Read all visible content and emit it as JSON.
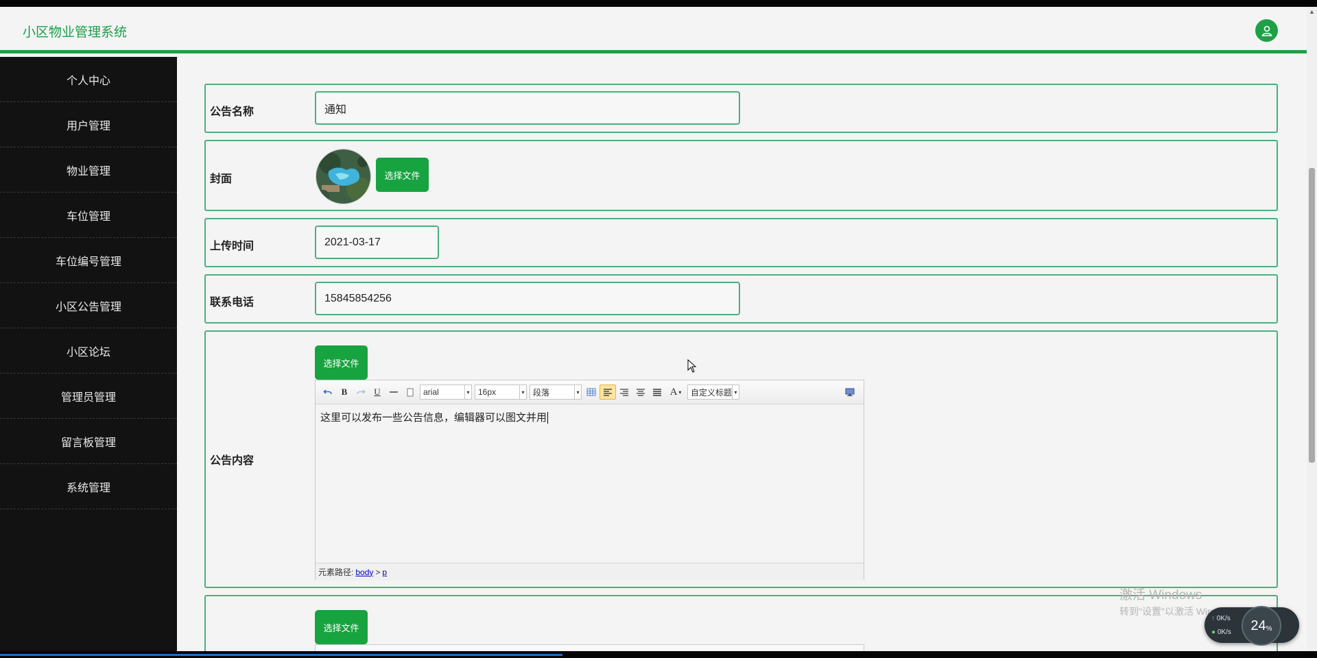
{
  "app": {
    "title": "小区物业管理系统"
  },
  "sidebar": {
    "items": [
      {
        "label": "个人中心"
      },
      {
        "label": "用户管理"
      },
      {
        "label": "物业管理"
      },
      {
        "label": "车位管理"
      },
      {
        "label": "车位编号管理"
      },
      {
        "label": "小区公告管理"
      },
      {
        "label": "小区论坛"
      },
      {
        "label": "管理员管理"
      },
      {
        "label": "留言板管理"
      },
      {
        "label": "系统管理"
      }
    ]
  },
  "form": {
    "name": {
      "label": "公告名称",
      "value": "通知"
    },
    "cover": {
      "label": "封面",
      "button": "选择文件"
    },
    "upload_time": {
      "label": "上传时间",
      "value": "2021-03-17"
    },
    "phone": {
      "label": "联系电话",
      "value": "15845854256"
    },
    "content": {
      "label": "公告内容",
      "button": "选择文件",
      "toolbar": {
        "font_family": "arial",
        "font_size": "16px",
        "paragraph": "段落",
        "custom_title": "自定义标题",
        "font_color_glyph": "A"
      },
      "text": "这里可以发布一些公告信息，编辑器可以图文并用",
      "status_prefix": "元素路径:",
      "status_path": [
        "body",
        "p"
      ],
      "status_sep": ">"
    },
    "next": {
      "button": "选择文件",
      "toolbar": {}
    }
  },
  "watermark": {
    "line1": "激活 Windows",
    "line2": "转到\"设置\"以激活 Windows。"
  },
  "netspeed": {
    "up": "0K/s",
    "down": "0K/s",
    "percent": "24",
    "percent_unit": "%"
  },
  "icons": {
    "avatar": "user-icon",
    "undo": "undo-icon",
    "redo": "redo-icon",
    "hr": "horizontal-rule-icon",
    "paste": "paste-icon",
    "table": "table-icon",
    "fullscreen": "fullscreen-icon"
  },
  "colors": {
    "brand": "#1e9e48",
    "accent": "#17a340",
    "border": "#49b07c",
    "sidebar": "#121212"
  }
}
